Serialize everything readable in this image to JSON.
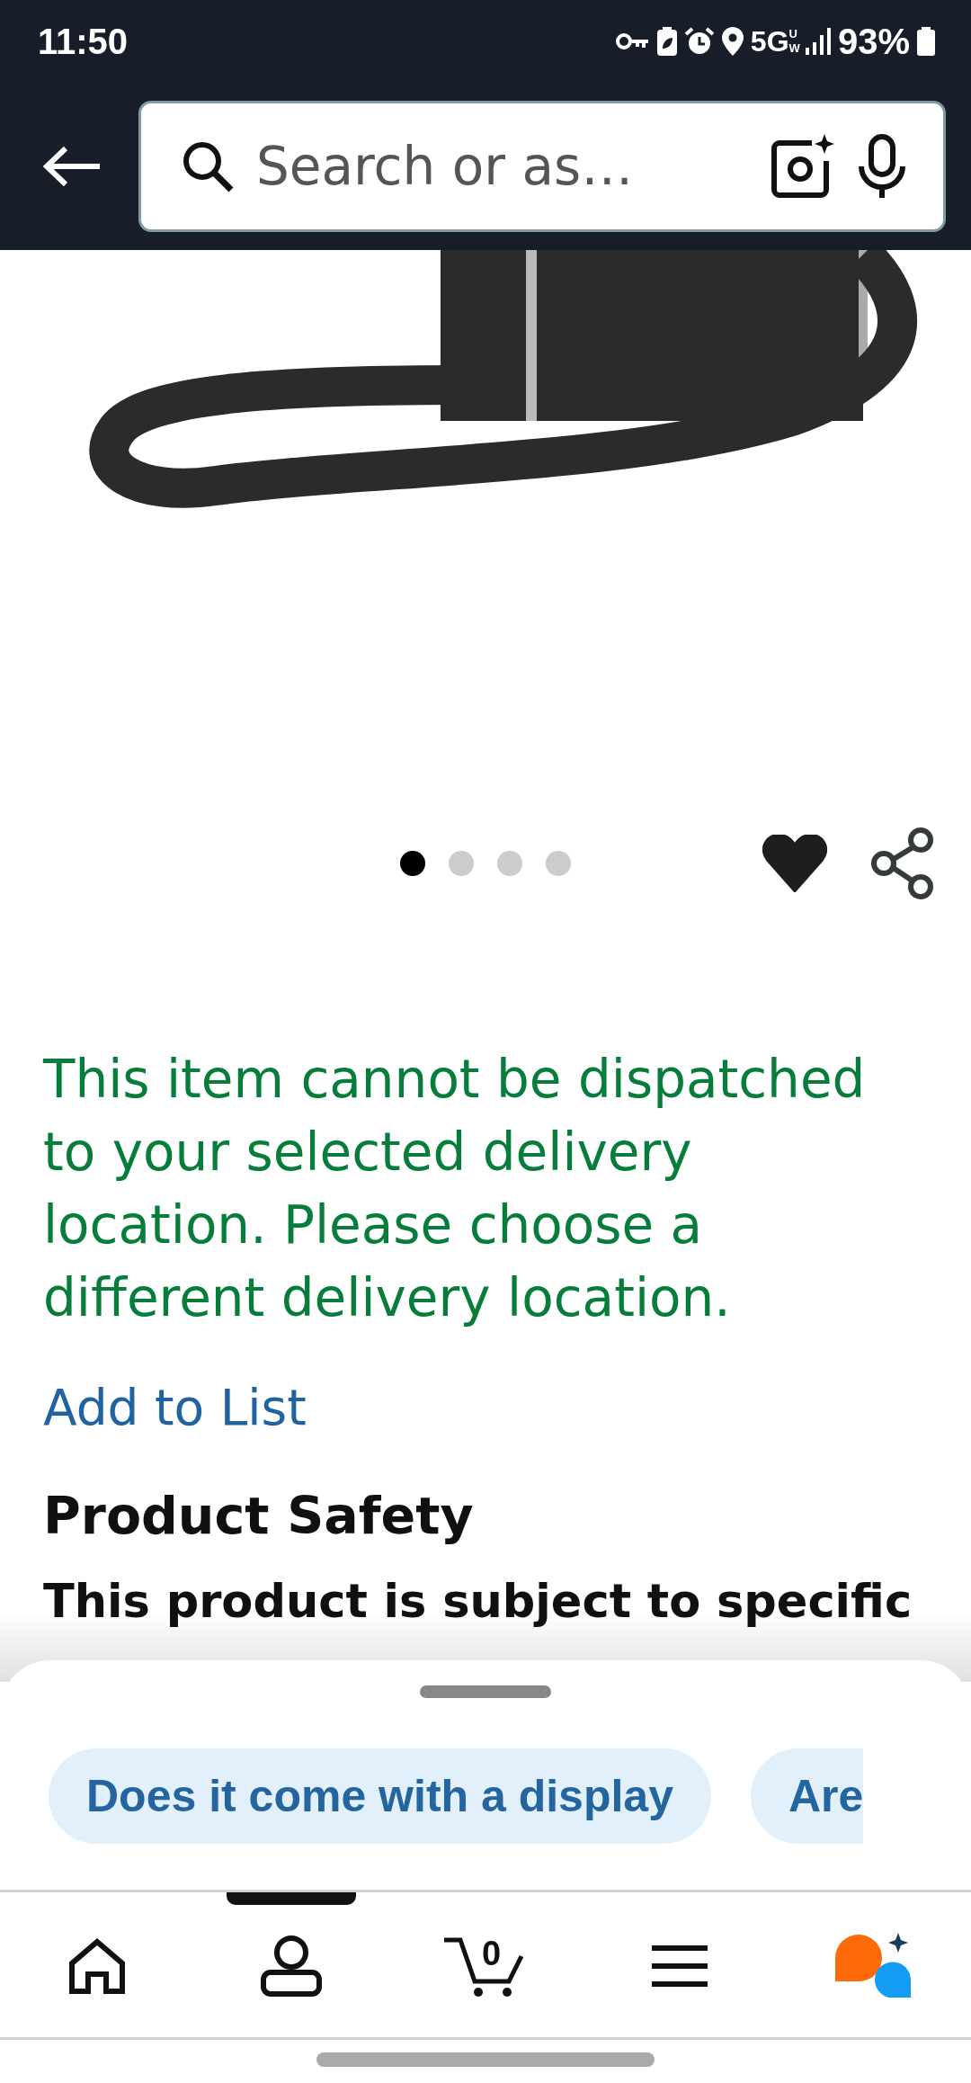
{
  "status_bar": {
    "time": "11:50",
    "network": "5G",
    "network_sub": "UW",
    "battery": "93%"
  },
  "search": {
    "placeholder": "Search or as…"
  },
  "carousel": {
    "dots": [
      {
        "selected": true
      },
      {
        "selected": false
      },
      {
        "selected": false
      },
      {
        "selected": false
      }
    ],
    "favorite": true
  },
  "message": "This item cannot be dispatched to your selected delivery location. Please choose a different delivery location.",
  "add_to_list": "Add to List",
  "section_title": "Product Safety",
  "section_text": "This product is subject to specific",
  "suggestions": [
    "Does it come with a display",
    "Are"
  ],
  "nav": [
    {
      "kind": "home",
      "selected": false
    },
    {
      "kind": "account",
      "selected": true
    },
    {
      "kind": "cart",
      "selected": false,
      "count": "0"
    },
    {
      "kind": "menu",
      "selected": false
    },
    {
      "kind": "assistant",
      "selected": false
    }
  ]
}
